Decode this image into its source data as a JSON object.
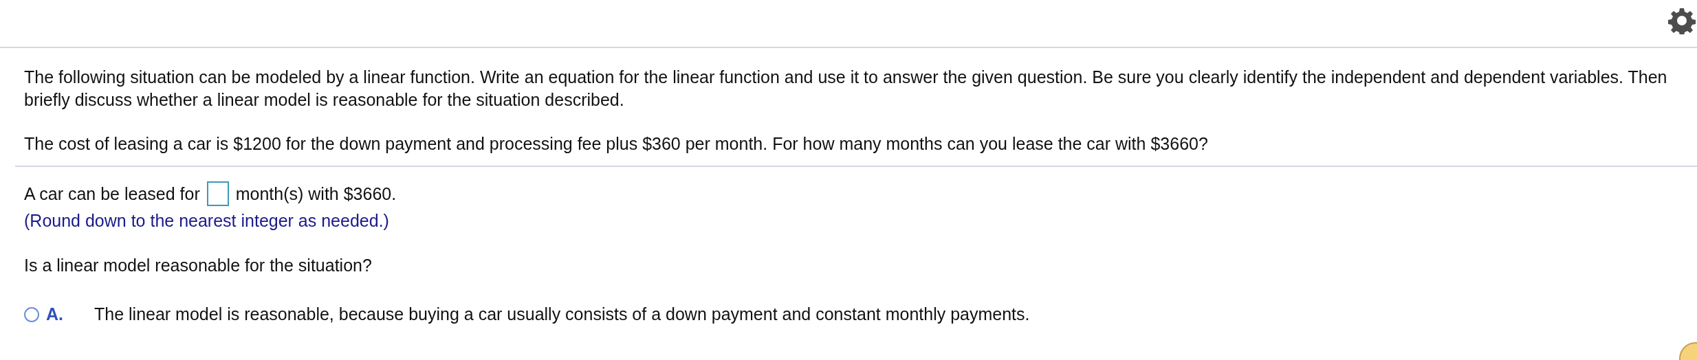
{
  "instructions": "The following situation can be modeled by a linear function. Write an equation for the linear function and use it to answer the given question. Be sure you clearly identify the independent and dependent variables. Then briefly discuss whether a linear model is reasonable for the situation described.",
  "problem": "The cost of leasing a car is $1200 for the down payment and processing fee plus $360 per month. For how many months can you lease the car with $3660?",
  "answer": {
    "prefix": "A car can be leased for",
    "suffix": "month(s) with $3660."
  },
  "hint": "(Round down to the nearest integer as needed.)",
  "question": "Is a linear model reasonable for the situation?",
  "options": [
    {
      "letter": "A.",
      "text": "The linear model is reasonable, because buying a car usually consists of a down payment and constant monthly payments.",
      "selected": false
    }
  ]
}
